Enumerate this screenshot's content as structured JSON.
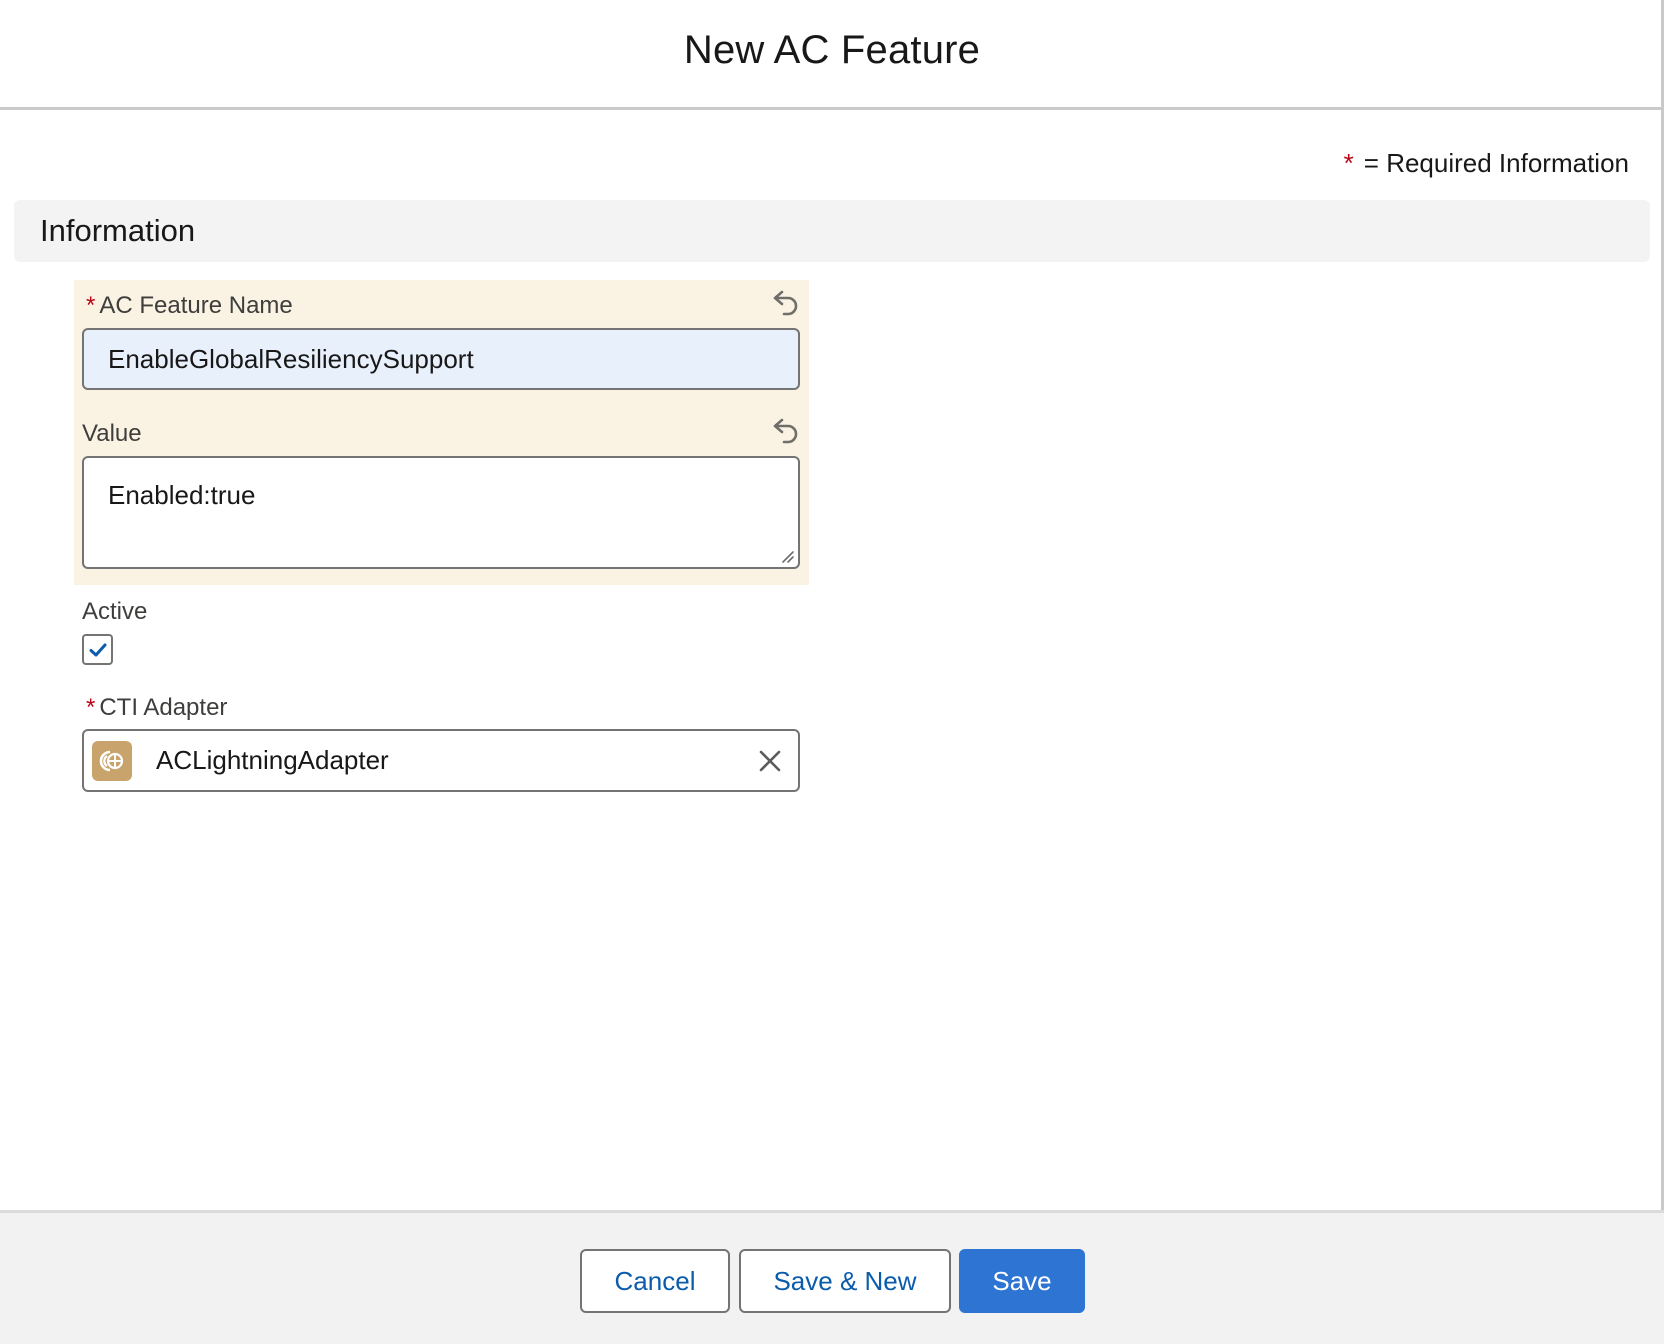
{
  "modal": {
    "title": "New AC Feature",
    "required_note_star": "*",
    "required_note_text": "= Required Information"
  },
  "section": {
    "title": "Information"
  },
  "fields": {
    "feature_name": {
      "required_marker": "*",
      "label": "AC Feature Name",
      "value": "EnableGlobalResiliencySupport"
    },
    "value": {
      "label": "Value",
      "value": "Enabled:true"
    },
    "active": {
      "label": "Active",
      "checked": true
    },
    "cti_adapter": {
      "required_marker": "*",
      "label": "CTI Adapter",
      "value": "ACLightningAdapter",
      "icon": "call-center-icon"
    }
  },
  "footer": {
    "cancel_label": "Cancel",
    "save_new_label": "Save & New",
    "save_label": "Save"
  },
  "colors": {
    "brand": "#2e74d3",
    "required": "#ba0517",
    "edited_highlight": "#faf3e3",
    "autofill_bg": "#e8f0fb"
  }
}
